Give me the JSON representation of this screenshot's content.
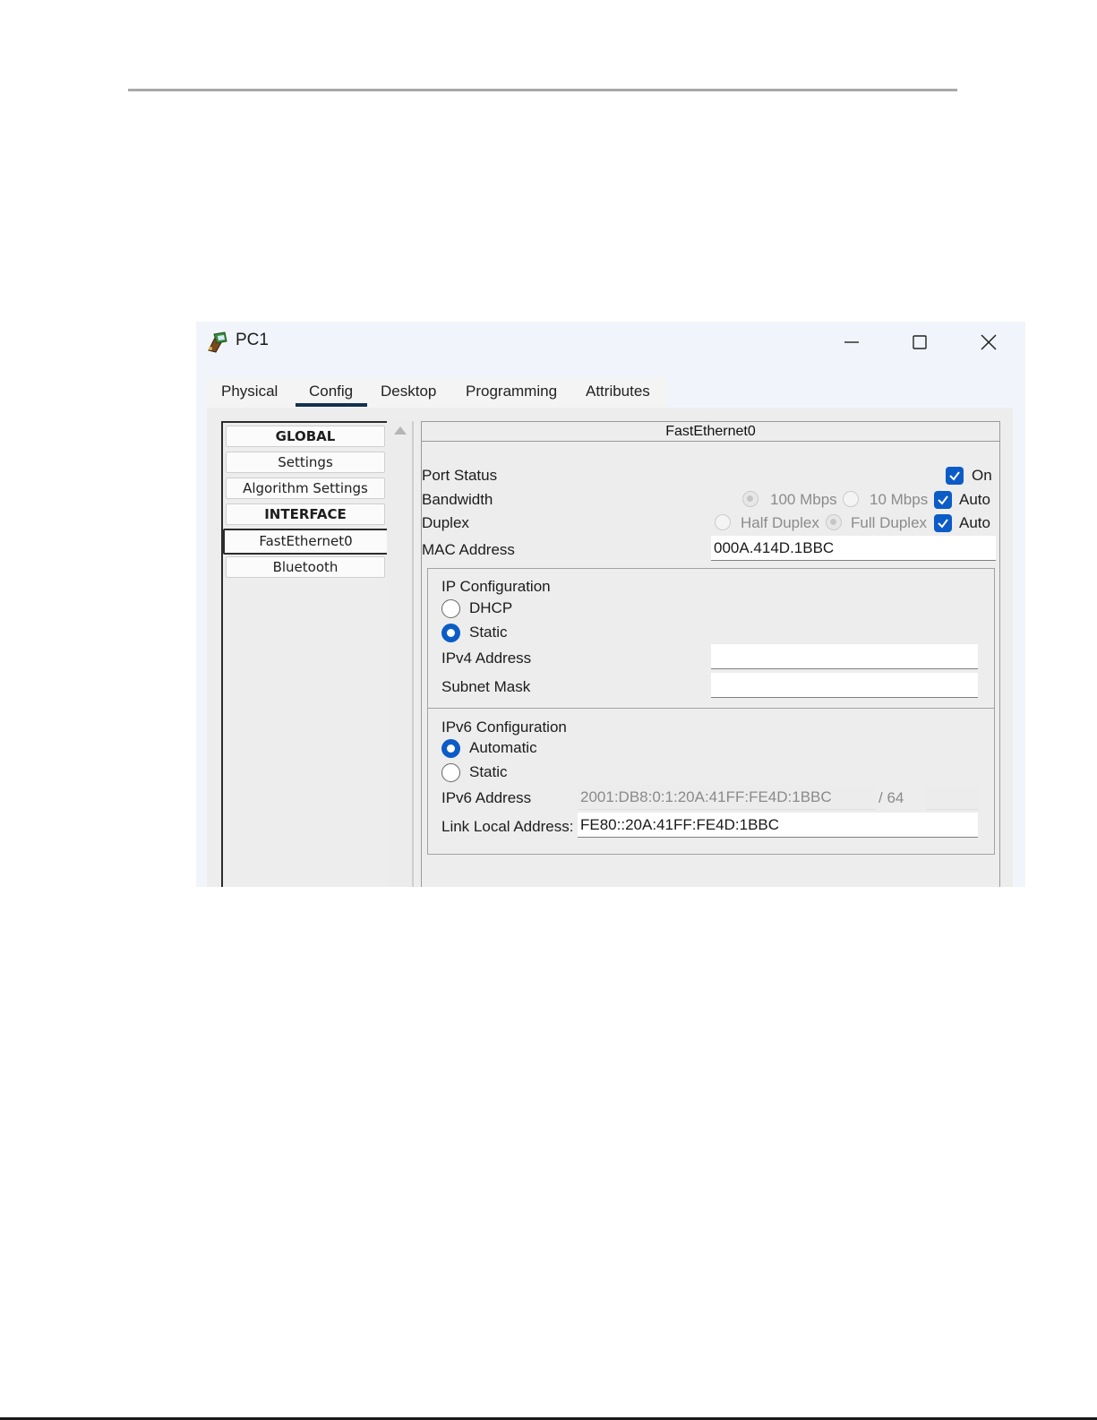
{
  "window": {
    "title": "PC1",
    "icon": "pc-device-icon"
  },
  "tabs": [
    "Physical",
    "Config",
    "Desktop",
    "Programming",
    "Attributes"
  ],
  "active_tab": "Config",
  "sidebar": {
    "items": [
      {
        "label": "GLOBAL",
        "type": "header"
      },
      {
        "label": "Settings",
        "type": "item"
      },
      {
        "label": "Algorithm Settings",
        "type": "item"
      },
      {
        "label": "INTERFACE",
        "type": "header"
      },
      {
        "label": "FastEthernet0",
        "type": "item",
        "selected": true
      },
      {
        "label": "Bluetooth",
        "type": "item"
      }
    ]
  },
  "panel": {
    "title": "FastEthernet0",
    "port_status": {
      "label": "Port Status",
      "on_label": "On",
      "on": true
    },
    "bandwidth": {
      "label": "Bandwidth",
      "option_100": "100 Mbps",
      "option_10": "10 Mbps",
      "auto_label": "Auto",
      "auto": true
    },
    "duplex": {
      "label": "Duplex",
      "half": "Half Duplex",
      "full": "Full Duplex",
      "auto_label": "Auto",
      "auto": true
    },
    "mac": {
      "label": "MAC Address",
      "value": "000A.414D.1BBC"
    },
    "ipv4": {
      "title": "IP Configuration",
      "dhcp_label": "DHCP",
      "static_label": "Static",
      "selected": "Static",
      "address_label": "IPv4 Address",
      "address_value": "",
      "mask_label": "Subnet Mask",
      "mask_value": ""
    },
    "ipv6": {
      "title": "IPv6 Configuration",
      "automatic_label": "Automatic",
      "static_label": "Static",
      "selected": "Automatic",
      "address_label": "IPv6 Address",
      "address_value": "2001:DB8:0:1:20A:41FF:FE4D:1BBC",
      "prefix": "/ 64",
      "link_local_label": "Link Local Address:",
      "link_local_value": "FE80::20A:41FF:FE4D:1BBC"
    }
  },
  "colors": {
    "accent": "#0b5cc7",
    "tab_underline": "#14324f"
  }
}
